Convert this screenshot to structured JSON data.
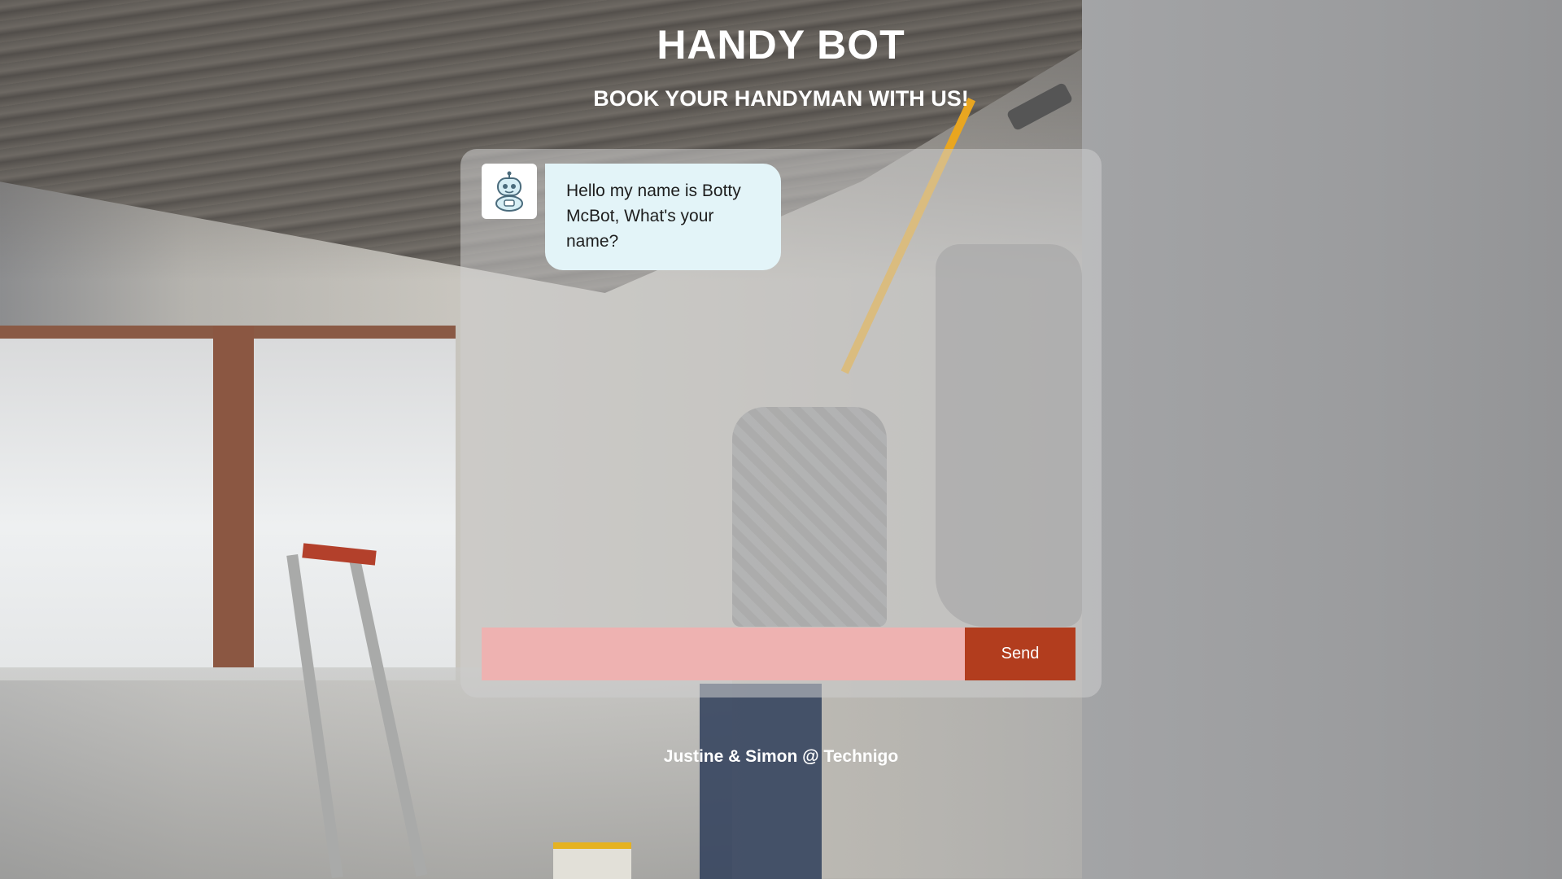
{
  "header": {
    "title": "HANDY BOT",
    "subtitle": "BOOK YOUR HANDYMAN WITH US!"
  },
  "chat": {
    "messages": [
      {
        "sender": "bot",
        "avatar_icon": "robot-icon",
        "text": "Hello my name is Botty McBot, What's your name?"
      }
    ],
    "input": {
      "value": "",
      "placeholder": ""
    },
    "send_label": "Send"
  },
  "footer": {
    "credit": "Justine & Simon @ Technigo"
  },
  "colors": {
    "bubble_bg": "#e3f4f8",
    "input_bg": "#eeb2b1",
    "send_bg": "#b23d1e",
    "panel_bg": "rgba(205,205,205,0.55)",
    "text_light": "#ffffff"
  }
}
